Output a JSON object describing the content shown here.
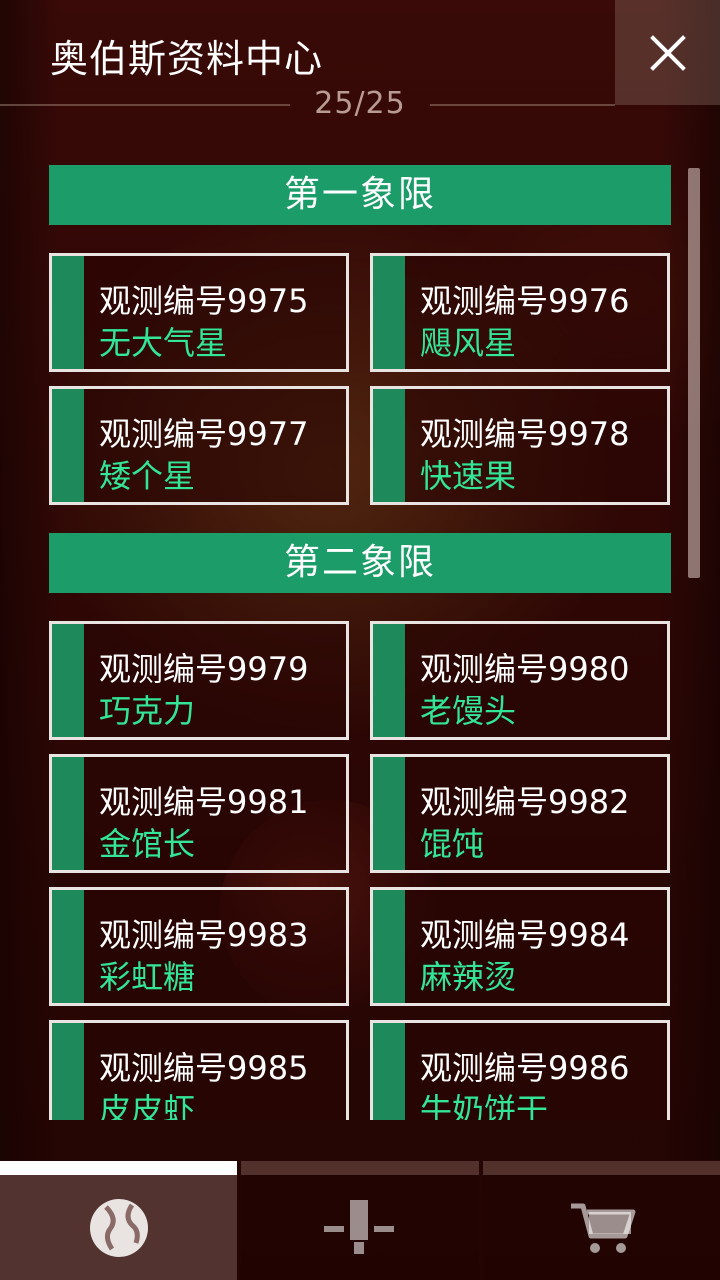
{
  "header": {
    "title": "奥伯斯资料中心",
    "counter": "25/25",
    "close_icon": "close-icon"
  },
  "sections": [
    {
      "title": "第一象限",
      "items": [
        {
          "code": "观测编号9975",
          "name": "无大气星"
        },
        {
          "code": "观测编号9976",
          "name": "飓风星"
        },
        {
          "code": "观测编号9977",
          "name": "矮个星"
        },
        {
          "code": "观测编号9978",
          "name": "快速果"
        }
      ]
    },
    {
      "title": "第二象限",
      "items": [
        {
          "code": "观测编号9979",
          "name": "巧克力"
        },
        {
          "code": "观测编号9980",
          "name": "老馒头"
        },
        {
          "code": "观测编号9981",
          "name": "金馆长"
        },
        {
          "code": "观测编号9982",
          "name": "馄饨"
        },
        {
          "code": "观测编号9983",
          "name": "彩虹糖"
        },
        {
          "code": "观测编号9984",
          "name": "麻辣烫"
        },
        {
          "code": "观测编号9985",
          "name": "皮皮虾"
        },
        {
          "code": "观测编号9986",
          "name": "牛奶饼干"
        }
      ]
    }
  ],
  "bottom_nav": [
    {
      "icon": "planet-icon",
      "selected": true
    },
    {
      "icon": "telescope-icon",
      "selected": false
    },
    {
      "icon": "cart-icon",
      "selected": false
    }
  ],
  "colors": {
    "accent_green": "#1b9c69",
    "name_green": "#33e596",
    "stripe_green": "#1e8a5c",
    "background": "#3a0a08"
  }
}
